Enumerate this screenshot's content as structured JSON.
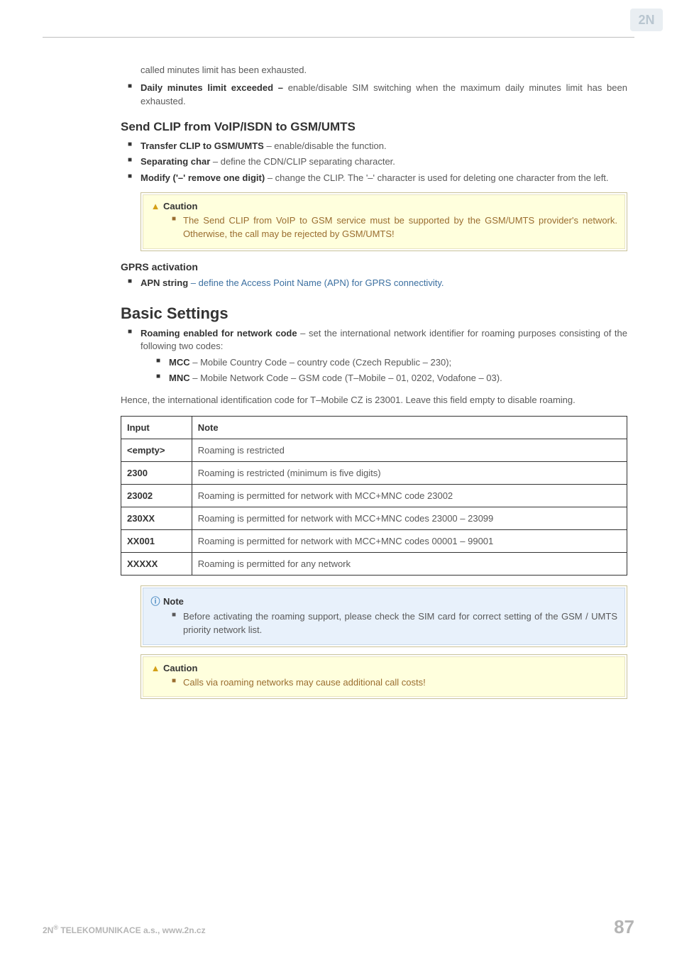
{
  "logo_alt": "2N",
  "intro_line": "called minutes limit has been exhausted.",
  "bullet_daily": {
    "bold": "Daily minutes limit exceeded – ",
    "rest": "enable/disable SIM switching when the maximum daily minutes limit has been exhausted."
  },
  "h_sendclip": "Send CLIP from VoIP/ISDN to GSM/UMTS",
  "sendclip_bullets": [
    {
      "bold": "Transfer CLIP to GSM/UMTS",
      "rest": " – enable/disable the function."
    },
    {
      "bold": "Separating char",
      "rest": " – define the CDN/CLIP separating character."
    },
    {
      "bold": "Modify ('–' remove one digit)",
      "rest": " – change the CLIP. The '–' character is used for deleting one character from the left."
    }
  ],
  "caution1": {
    "title": "Caution",
    "text": "The Send CLIP from VoIP to GSM service must be supported by the GSM/UMTS provider's network. Otherwise, the call may be rejected by GSM/UMTS!"
  },
  "h_gprs": "GPRS activation",
  "gprs_bullet": {
    "bold": "APN string",
    "rest": " – define the Access Point Name (APN) for GPRS connectivity."
  },
  "h_basic": "Basic Settings",
  "basic_bullet": {
    "bold": "Roaming enabled for network code",
    "rest": " – set the international network identifier for roaming purposes consisting of the following two codes:"
  },
  "basic_sub": [
    {
      "bold": "MCC",
      "rest": " – Mobile Country Code – country code (Czech Republic – 230);"
    },
    {
      "bold": "MNC",
      "rest": " – Mobile Network Code – GSM code (T–Mobile – 01, 0202, Vodafone – 03)."
    }
  ],
  "basic_para": "Hence, the international identification code for T–Mobile CZ is 23001. Leave this field empty to disable roaming.",
  "table": {
    "headers": [
      "Input",
      "Note"
    ],
    "rows": [
      [
        "<empty>",
        "Roaming is restricted"
      ],
      [
        "2300",
        "Roaming is restricted (minimum is five digits)"
      ],
      [
        "23002",
        "Roaming is permitted for network with MCC+MNC code 23002"
      ],
      [
        "230XX",
        "Roaming is permitted for network with MCC+MNC codes  23000 – 23099"
      ],
      [
        "XX001",
        "Roaming is permitted for network with MCC+MNC codes  00001 – 99001"
      ],
      [
        "XXXXX",
        "Roaming is permitted for any network"
      ]
    ]
  },
  "note1": {
    "title": "Note",
    "text": "Before activating the roaming support, please check the SIM card for correct setting of the GSM / UMTS priority network list."
  },
  "caution2": {
    "title": "Caution",
    "text": "Calls via roaming networks may cause additional call costs!"
  },
  "footer": {
    "left_pre": "2N",
    "left_sup": "®",
    "left_rest": " TELEKOMUNIKACE a.s., www.2n.cz",
    "page": "87"
  }
}
